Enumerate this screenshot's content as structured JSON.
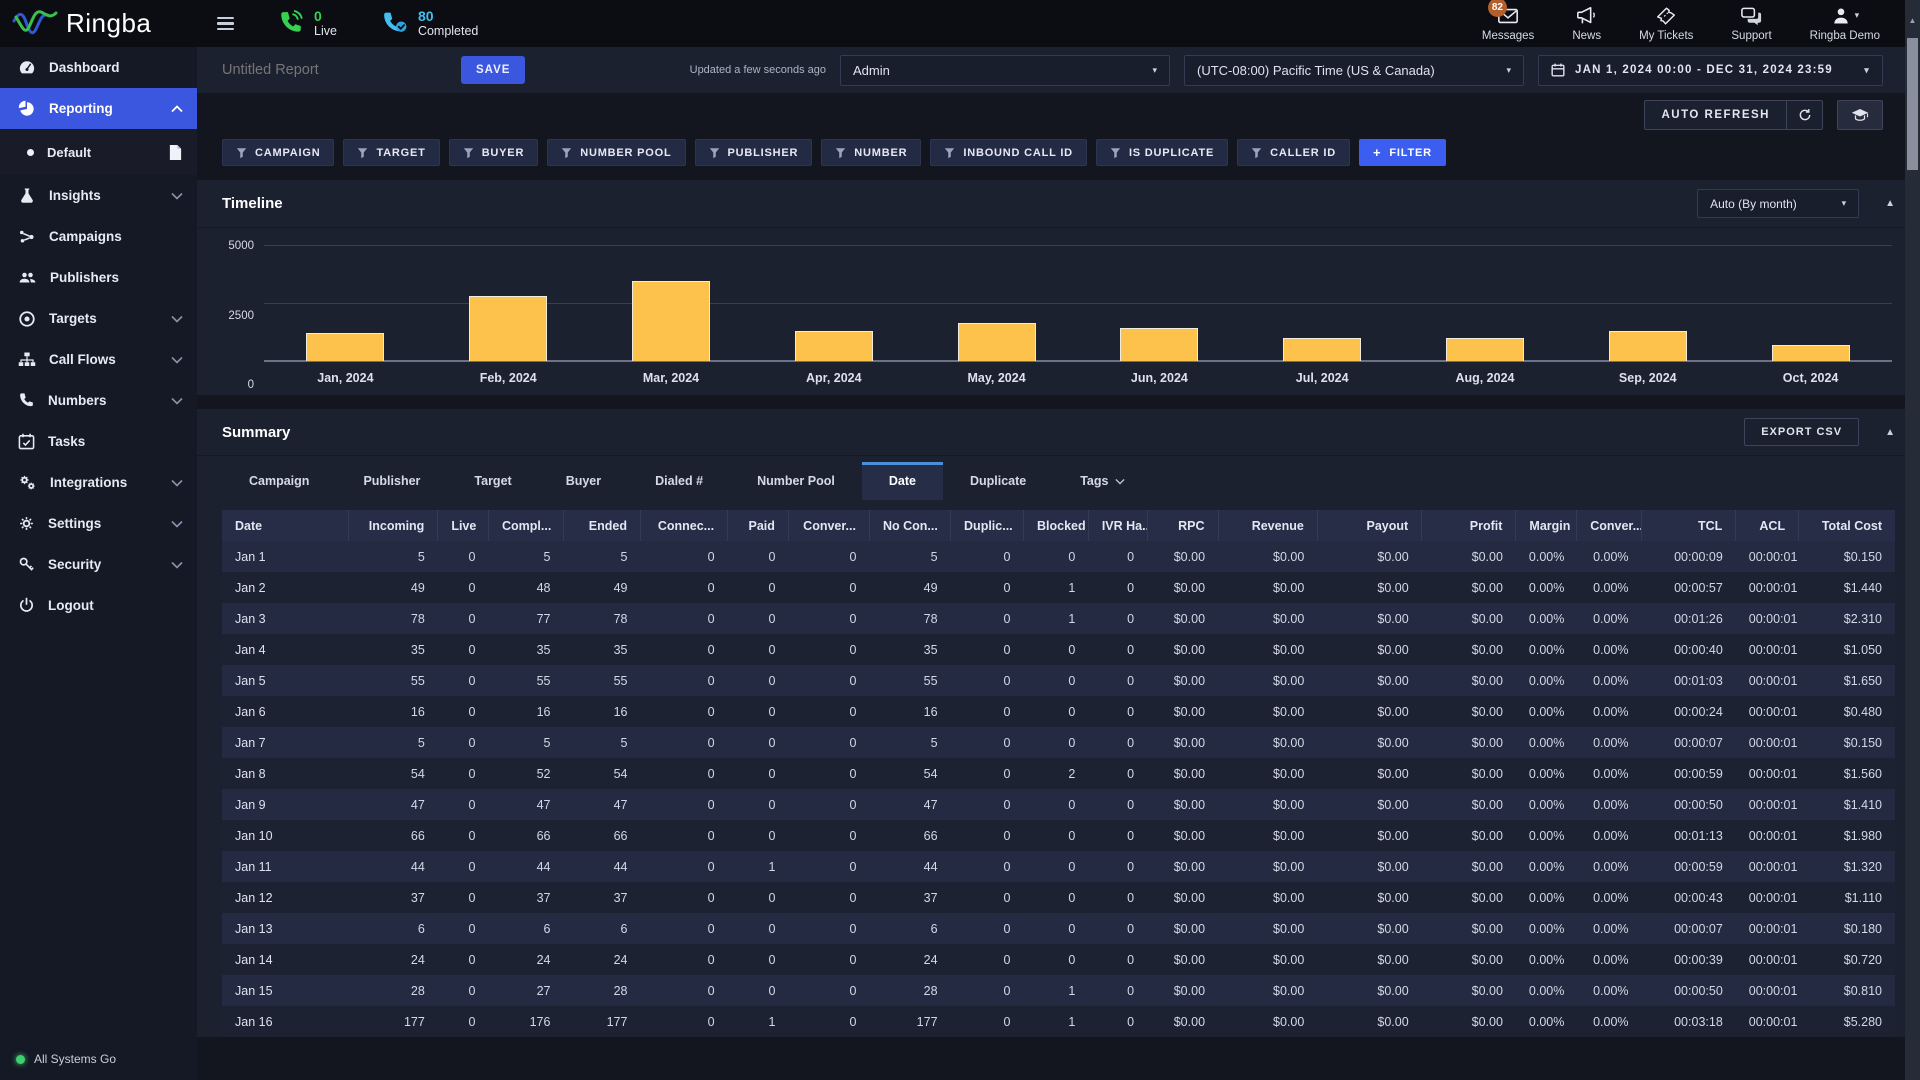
{
  "topbar": {
    "brand": "Ringba",
    "live": {
      "count": "0",
      "label": "Live"
    },
    "completed": {
      "count": "80",
      "label": "Completed"
    },
    "actions": [
      {
        "id": "messages",
        "label": "Messages",
        "badge": "82"
      },
      {
        "id": "news",
        "label": "News"
      },
      {
        "id": "tickets",
        "label": "My Tickets"
      },
      {
        "id": "support",
        "label": "Support"
      },
      {
        "id": "account",
        "label": "Ringba Demo"
      }
    ]
  },
  "sidebar": {
    "items": [
      {
        "id": "dashboard",
        "label": "Dashboard"
      },
      {
        "id": "reporting",
        "label": "Reporting"
      },
      {
        "id": "default",
        "label": "Default"
      },
      {
        "id": "insights",
        "label": "Insights"
      },
      {
        "id": "campaigns",
        "label": "Campaigns"
      },
      {
        "id": "publishers",
        "label": "Publishers"
      },
      {
        "id": "targets",
        "label": "Targets"
      },
      {
        "id": "callflows",
        "label": "Call Flows"
      },
      {
        "id": "numbers",
        "label": "Numbers"
      },
      {
        "id": "tasks",
        "label": "Tasks"
      },
      {
        "id": "integrations",
        "label": "Integrations"
      },
      {
        "id": "settings",
        "label": "Settings"
      },
      {
        "id": "security",
        "label": "Security"
      },
      {
        "id": "logout",
        "label": "Logout"
      }
    ],
    "status": "All Systems Go"
  },
  "report_header": {
    "name_placeholder": "Untitled Report",
    "save_label": "SAVE",
    "updated": "Updated a few seconds ago",
    "user_select": "Admin",
    "timezone_select": "(UTC-08:00) Pacific Time (US & Canada)",
    "date_range": "JAN 1, 2024 00:00 - DEC 31, 2024 23:59",
    "auto_refresh_label": "AUTO REFRESH"
  },
  "filters": {
    "chips": [
      "CAMPAIGN",
      "TARGET",
      "BUYER",
      "NUMBER POOL",
      "PUBLISHER",
      "NUMBER",
      "INBOUND CALL ID",
      "IS DUPLICATE",
      "CALLER ID"
    ],
    "add_label": "FILTER"
  },
  "timeline": {
    "title": "Timeline",
    "grouping": "Auto (By month)"
  },
  "chart_data": {
    "type": "bar",
    "title": "Timeline",
    "categories": [
      "Jan, 2024",
      "Feb, 2024",
      "Mar, 2024",
      "Apr, 2024",
      "May, 2024",
      "Jun, 2024",
      "Jul, 2024",
      "Aug, 2024",
      "Sep, 2024",
      "Oct, 2024"
    ],
    "values": [
      1210,
      2835,
      3490,
      1325,
      1660,
      1430,
      1020,
      1005,
      1285,
      685
    ],
    "xlabel": "",
    "ylabel": "",
    "ylim": [
      0,
      5000
    ],
    "yticks": [
      0,
      2500,
      5000
    ],
    "grid": true,
    "legend": false,
    "bar_color": "#fcc24c"
  },
  "summary": {
    "title": "Summary",
    "export_label": "EXPORT CSV",
    "tabs": [
      {
        "label": "Campaign"
      },
      {
        "label": "Publisher"
      },
      {
        "label": "Target"
      },
      {
        "label": "Buyer"
      },
      {
        "label": "Dialed #"
      },
      {
        "label": "Number Pool"
      },
      {
        "label": "Date",
        "active": true
      },
      {
        "label": "Duplicate"
      },
      {
        "label": "Tags",
        "caret": true
      }
    ]
  },
  "table": {
    "columns": [
      "Date",
      "Incoming",
      "Live",
      "Compl...",
      "Ended",
      "Connec...",
      "Paid",
      "Conver...",
      "No Con...",
      "Duplic...",
      "Blocked",
      "IVR Ha...",
      "RPC",
      "Revenue",
      "Payout",
      "Profit",
      "Margin",
      "Conver...",
      "TCL",
      "ACL",
      "Total Cost"
    ],
    "rows": [
      [
        "Jan 1",
        "5",
        "0",
        "5",
        "5",
        "0",
        "0",
        "0",
        "5",
        "0",
        "0",
        "0",
        "$0.00",
        "$0.00",
        "$0.00",
        "$0.00",
        "0.00%",
        "0.00%",
        "00:00:09",
        "00:00:01",
        "$0.150"
      ],
      [
        "Jan 2",
        "49",
        "0",
        "48",
        "49",
        "0",
        "0",
        "0",
        "49",
        "0",
        "1",
        "0",
        "$0.00",
        "$0.00",
        "$0.00",
        "$0.00",
        "0.00%",
        "0.00%",
        "00:00:57",
        "00:00:01",
        "$1.440"
      ],
      [
        "Jan 3",
        "78",
        "0",
        "77",
        "78",
        "0",
        "0",
        "0",
        "78",
        "0",
        "1",
        "0",
        "$0.00",
        "$0.00",
        "$0.00",
        "$0.00",
        "0.00%",
        "0.00%",
        "00:01:26",
        "00:00:01",
        "$2.310"
      ],
      [
        "Jan 4",
        "35",
        "0",
        "35",
        "35",
        "0",
        "0",
        "0",
        "35",
        "0",
        "0",
        "0",
        "$0.00",
        "$0.00",
        "$0.00",
        "$0.00",
        "0.00%",
        "0.00%",
        "00:00:40",
        "00:00:01",
        "$1.050"
      ],
      [
        "Jan 5",
        "55",
        "0",
        "55",
        "55",
        "0",
        "0",
        "0",
        "55",
        "0",
        "0",
        "0",
        "$0.00",
        "$0.00",
        "$0.00",
        "$0.00",
        "0.00%",
        "0.00%",
        "00:01:03",
        "00:00:01",
        "$1.650"
      ],
      [
        "Jan 6",
        "16",
        "0",
        "16",
        "16",
        "0",
        "0",
        "0",
        "16",
        "0",
        "0",
        "0",
        "$0.00",
        "$0.00",
        "$0.00",
        "$0.00",
        "0.00%",
        "0.00%",
        "00:00:24",
        "00:00:01",
        "$0.480"
      ],
      [
        "Jan 7",
        "5",
        "0",
        "5",
        "5",
        "0",
        "0",
        "0",
        "5",
        "0",
        "0",
        "0",
        "$0.00",
        "$0.00",
        "$0.00",
        "$0.00",
        "0.00%",
        "0.00%",
        "00:00:07",
        "00:00:01",
        "$0.150"
      ],
      [
        "Jan 8",
        "54",
        "0",
        "52",
        "54",
        "0",
        "0",
        "0",
        "54",
        "0",
        "2",
        "0",
        "$0.00",
        "$0.00",
        "$0.00",
        "$0.00",
        "0.00%",
        "0.00%",
        "00:00:59",
        "00:00:01",
        "$1.560"
      ],
      [
        "Jan 9",
        "47",
        "0",
        "47",
        "47",
        "0",
        "0",
        "0",
        "47",
        "0",
        "0",
        "0",
        "$0.00",
        "$0.00",
        "$0.00",
        "$0.00",
        "0.00%",
        "0.00%",
        "00:00:50",
        "00:00:01",
        "$1.410"
      ],
      [
        "Jan 10",
        "66",
        "0",
        "66",
        "66",
        "0",
        "0",
        "0",
        "66",
        "0",
        "0",
        "0",
        "$0.00",
        "$0.00",
        "$0.00",
        "$0.00",
        "0.00%",
        "0.00%",
        "00:01:13",
        "00:00:01",
        "$1.980"
      ],
      [
        "Jan 11",
        "44",
        "0",
        "44",
        "44",
        "0",
        "1",
        "0",
        "44",
        "0",
        "0",
        "0",
        "$0.00",
        "$0.00",
        "$0.00",
        "$0.00",
        "0.00%",
        "0.00%",
        "00:00:59",
        "00:00:01",
        "$1.320"
      ],
      [
        "Jan 12",
        "37",
        "0",
        "37",
        "37",
        "0",
        "0",
        "0",
        "37",
        "0",
        "0",
        "0",
        "$0.00",
        "$0.00",
        "$0.00",
        "$0.00",
        "0.00%",
        "0.00%",
        "00:00:43",
        "00:00:01",
        "$1.110"
      ],
      [
        "Jan 13",
        "6",
        "0",
        "6",
        "6",
        "0",
        "0",
        "0",
        "6",
        "0",
        "0",
        "0",
        "$0.00",
        "$0.00",
        "$0.00",
        "$0.00",
        "0.00%",
        "0.00%",
        "00:00:07",
        "00:00:01",
        "$0.180"
      ],
      [
        "Jan 14",
        "24",
        "0",
        "24",
        "24",
        "0",
        "0",
        "0",
        "24",
        "0",
        "0",
        "0",
        "$0.00",
        "$0.00",
        "$0.00",
        "$0.00",
        "0.00%",
        "0.00%",
        "00:00:39",
        "00:00:01",
        "$0.720"
      ],
      [
        "Jan 15",
        "28",
        "0",
        "27",
        "28",
        "0",
        "0",
        "0",
        "28",
        "0",
        "1",
        "0",
        "$0.00",
        "$0.00",
        "$0.00",
        "$0.00",
        "0.00%",
        "0.00%",
        "00:00:50",
        "00:00:01",
        "$0.810"
      ],
      [
        "Jan 16",
        "177",
        "0",
        "176",
        "177",
        "0",
        "1",
        "0",
        "177",
        "0",
        "1",
        "0",
        "$0.00",
        "$0.00",
        "$0.00",
        "$0.00",
        "0.00%",
        "0.00%",
        "00:03:18",
        "00:00:01",
        "$5.280"
      ]
    ]
  },
  "colors": {
    "accent_blue": "#3b57df",
    "filter_blue": "#3b5ef0",
    "bar_yellow": "#fcc24c",
    "live_green": "#35d14f",
    "completed_blue": "#45bdef",
    "badge_orange": "#b35f2c",
    "status_green": "#3ecf6f"
  }
}
